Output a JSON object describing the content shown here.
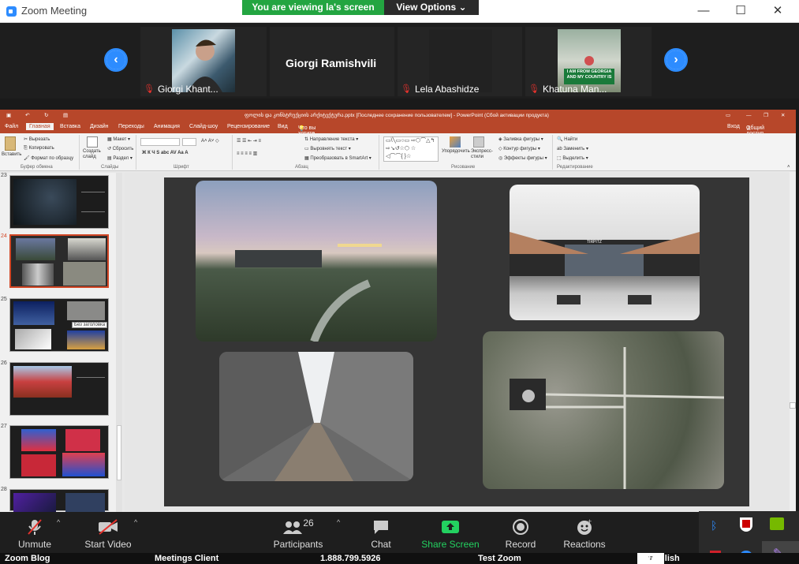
{
  "window": {
    "title": "Zoom Meeting"
  },
  "share_banner": {
    "viewing": "You are viewing la's screen",
    "options": "View Options"
  },
  "participants_strip": [
    {
      "name": "Giorgi Khant...",
      "muted": true
    },
    {
      "name": "Giorgi Ramishvili",
      "muted": false
    },
    {
      "name": "Lela Abashidze",
      "muted": true
    },
    {
      "name": "Khatuna Man...",
      "muted": true
    }
  ],
  "sign_text": "I AM FROM GEORGIA AND MY COUNTRY IS",
  "ppt": {
    "title": "ფოლის და კონსტრუქციის არქიტექტურა.pptx [Последнее сохранение пользователем] - PowerPoint (Сбой активации продукта)",
    "tabs": [
      "Файл",
      "Главная",
      "Вставка",
      "Дизайн",
      "Переходы",
      "Анимация",
      "Слайд-шоу",
      "Рецензирование",
      "Вид",
      "Что вы хотите сделать?"
    ],
    "right_tabs": [
      "Вход",
      "Общий доступ"
    ],
    "ribbon": {
      "clipboard": {
        "paste": "Вставить",
        "cut": "Вырезать",
        "copy": "Копировать",
        "format": "Формат по образцу",
        "group": "Буфер обмена"
      },
      "slides": {
        "new": "Создать слайд",
        "layout": "Макет",
        "reset": "Сбросить",
        "section": "Раздел",
        "group": "Слайды"
      },
      "font": {
        "group": "Шрифт"
      },
      "paragraph": {
        "direction": "Направление текста",
        "align": "Выровнять текст",
        "smartart": "Преобразовать в SmartArt",
        "group": "Абзац"
      },
      "drawing": {
        "arrange": "Упорядочить",
        "styles": "Экспресс-стили",
        "fill": "Заливка фигуры",
        "outline": "Контур фигуры",
        "effects": "Эффекты фигуры",
        "group": "Рисование"
      },
      "editing": {
        "find": "Найти",
        "replace": "Заменить",
        "select": "Выделить",
        "group": "Редактирование"
      }
    },
    "slide_numbers": [
      "23",
      "24",
      "25",
      "26",
      "27",
      "28"
    ],
    "tooltip": "Без заголовка",
    "slide_sign": "TIRPITZ"
  },
  "toolbar": {
    "unmute": "Unmute",
    "start_video": "Start Video",
    "participants": "Participants",
    "participants_count": "26",
    "chat": "Chat",
    "share": "Share Screen",
    "record": "Record",
    "reactions": "Reactions"
  },
  "taskbar": {
    "items": [
      "Zoom Blog",
      "Meetings Client",
      "1.888.799.5926",
      "Test Zoom",
      "English"
    ]
  },
  "colors": {
    "zoom_blue": "#2d8cff",
    "green": "#23a541",
    "ppt_red": "#b7472a"
  }
}
